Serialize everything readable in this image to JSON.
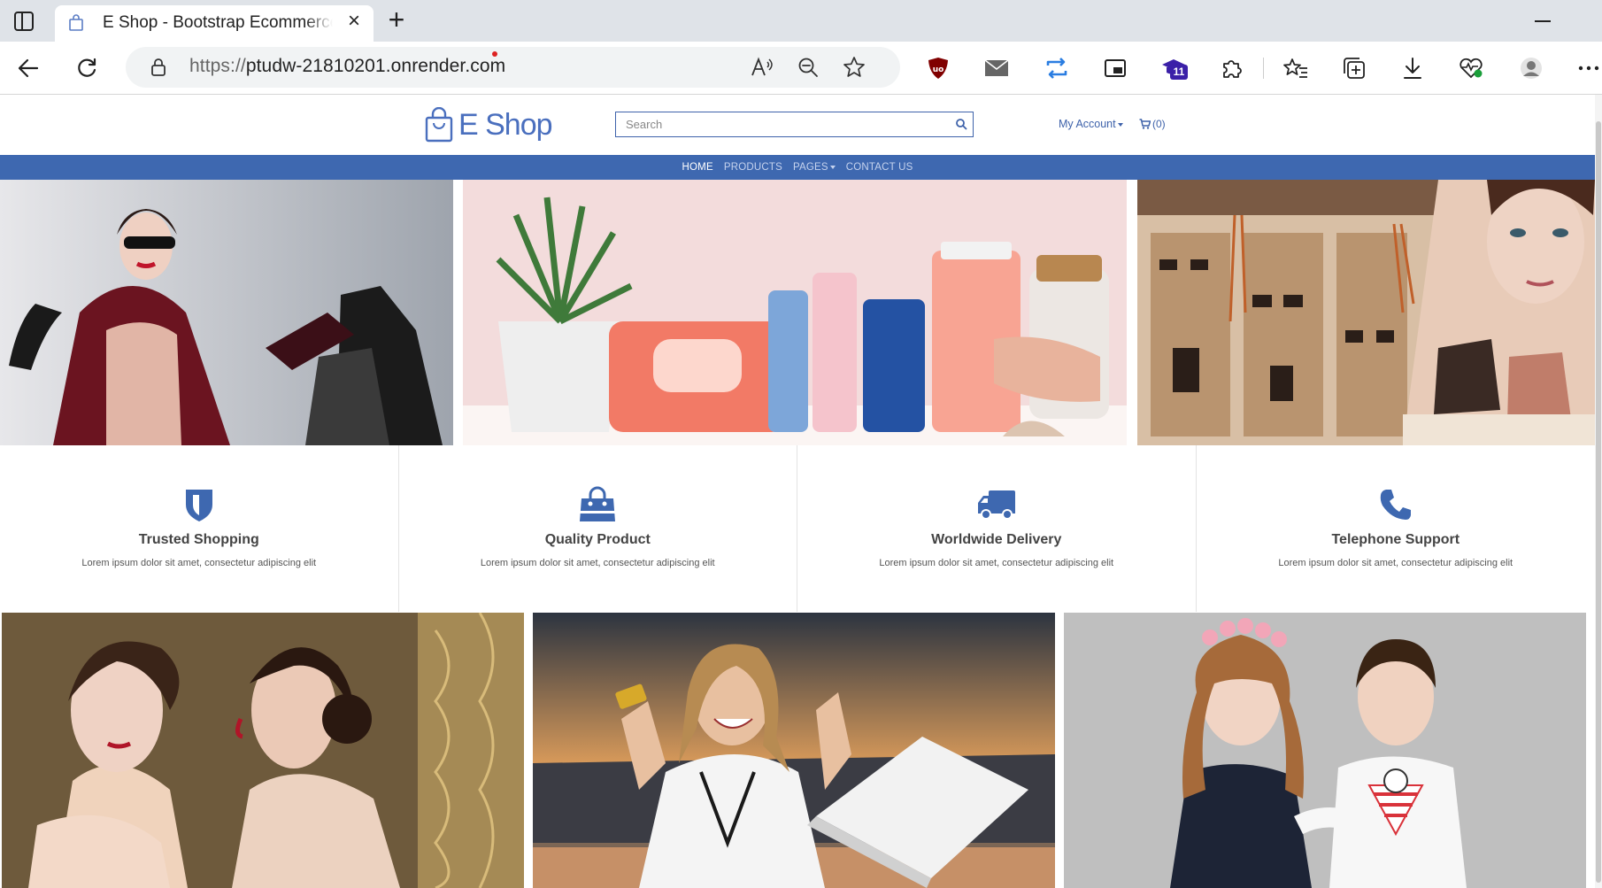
{
  "browser": {
    "tab_title": "E Shop - Bootstrap Ecommerce T",
    "url_scheme": "https://",
    "url_host": "ptudw-21810201.onrender.com",
    "extension_badge": "11"
  },
  "header": {
    "logo_text": "E Shop",
    "search_placeholder": "Search",
    "account_label": "My Account",
    "cart_label": "(0)"
  },
  "nav": {
    "items": [
      {
        "label": "HOME",
        "active": true
      },
      {
        "label": "PRODUCTS"
      },
      {
        "label": "PAGES"
      },
      {
        "label": "CONTACT US"
      }
    ]
  },
  "features": [
    {
      "icon": "shield-icon",
      "title": "Trusted Shopping",
      "desc": "Lorem ipsum dolor sit amet, consectetur adipiscing elit"
    },
    {
      "icon": "shopping-bag-icon",
      "title": "Quality Product",
      "desc": "Lorem ipsum dolor sit amet, consectetur adipiscing elit"
    },
    {
      "icon": "truck-icon",
      "title": "Worldwide Delivery",
      "desc": "Lorem ipsum dolor sit amet, consectetur adipiscing elit"
    },
    {
      "icon": "phone-icon",
      "title": "Telephone Support",
      "desc": "Lorem ipsum dolor sit amet, consectetur adipiscing elit"
    }
  ],
  "colors": {
    "brand": "#3e68b0",
    "brand_text": "#3e62aa"
  }
}
